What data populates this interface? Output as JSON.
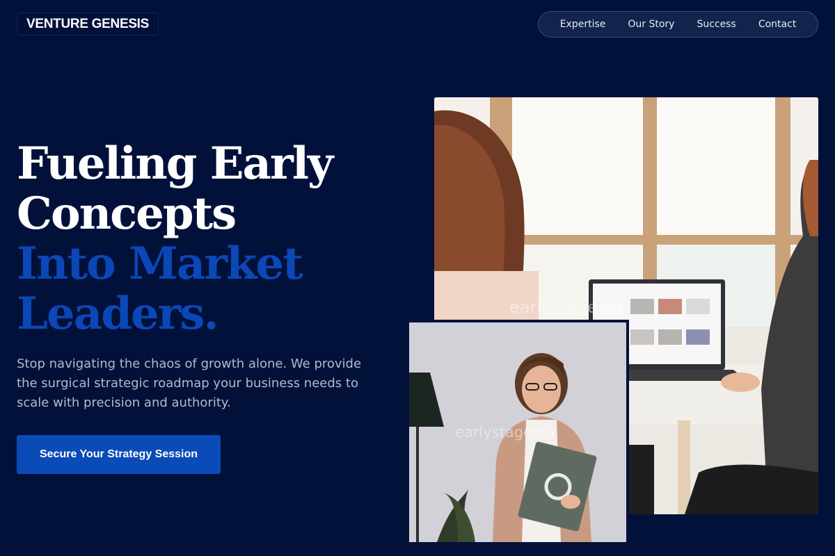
{
  "header": {
    "logo": "VENTURE GENESIS",
    "nav": [
      "Expertise",
      "Our Story",
      "Success",
      "Contact"
    ]
  },
  "hero": {
    "headline_lines": [
      "Fueling Early",
      "Concepts",
      "Into Market",
      "Leaders."
    ],
    "subtext": "Stop navigating the chaos of growth alone. We provide the surgical strategic roadmap your business needs to scale with precision and authority.",
    "cta": "Secure Your Strategy Session"
  },
  "images": {
    "main_watermark": "earlystagedia",
    "inset_watermark": "earlystagedia"
  },
  "colors": {
    "background": "#02113a",
    "accent_blue": "#0b47b6",
    "nav_background": "#13244c"
  }
}
